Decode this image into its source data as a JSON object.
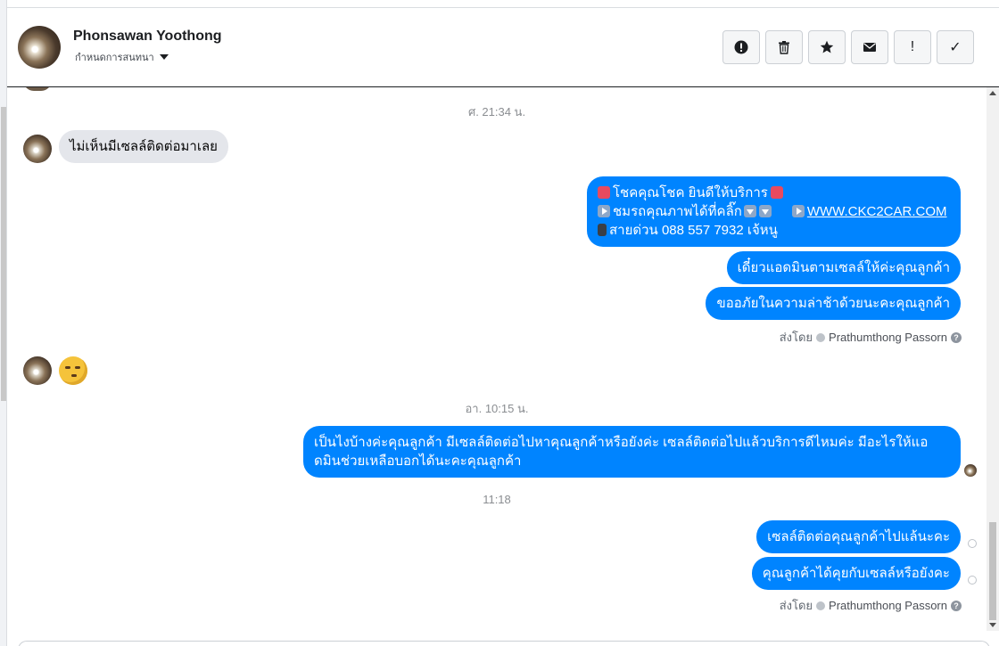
{
  "header": {
    "contact_name": "Phonsawan Yoothong",
    "subtitle": "กำหนดการสนทนา",
    "tools": [
      {
        "name": "report-button",
        "icon": "exclamation-circle-icon"
      },
      {
        "name": "delete-button",
        "icon": "trash-icon"
      },
      {
        "name": "star-button",
        "icon": "star-icon"
      },
      {
        "name": "mark-unread-button",
        "icon": "envelope-icon"
      },
      {
        "name": "follow-up-button",
        "icon": "exclamation-icon",
        "glyph": "!"
      },
      {
        "name": "mark-done-button",
        "icon": "check-icon",
        "glyph": "✓"
      }
    ]
  },
  "thread": {
    "timestamps": {
      "t1": "ศ. 21:34 น.",
      "t2": "อา. 10:15 น.",
      "t3": "11:18"
    },
    "messages": {
      "m1": "ไม่เห็นมีเซลล์ติดต่อมาเลย",
      "m2_line1": "โชคคุณโชค ยินดีให้บริการ",
      "m2_line2a": "ชมรถคุณภาพได้ที่คลิ๊ก",
      "m2_link": "WWW.CKC2CAR.COM",
      "m2_line3": "สายด่วน 088 557 7932 เจ้หนู",
      "m3": "เดี๋ยวแอดมินตามเซลล์ให้ค่ะคุณลูกค้า",
      "m4": "ขออภัยในความล่าช้าด้วยนะคะคุณลูกค้า",
      "m6": "เป็นไงบ้างค่ะคุณลูกค้า มีเซลล์ติดต่อไปหาคุณลูกค้าหรือยังค่ะ  เซลล์ติดต่อไปแล้วบริการดีไหมค่ะ มีอะไรให้แอดมินช่วยเหลือบอกได้นะคะคุณลูกค้า",
      "m7": "เซลล์ติดต่อคุณลูกค้าไปแล้นะคะ",
      "m8": "คุณลูกค้าได้คุยกับเซลล์หรือยังคะ"
    },
    "sent_by": {
      "prefix": "ส่งโดย",
      "admin": "Prathumthong Passorn"
    },
    "colors": {
      "outgoing": "#0084ff",
      "incoming": "#e4e6eb"
    }
  }
}
